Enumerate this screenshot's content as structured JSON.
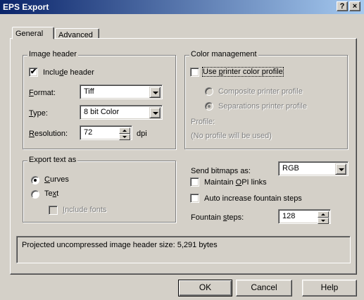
{
  "window": {
    "title": "EPS Export",
    "help_label": "?",
    "close_label": "×"
  },
  "tabs": [
    {
      "label": "General",
      "active": true
    },
    {
      "label": "Advanced",
      "active": false
    }
  ],
  "image_header": {
    "legend": "Image header",
    "include_header": {
      "pre": "Inclu",
      "u": "d",
      "post": "e header",
      "checked": true
    },
    "format": {
      "u": "F",
      "post": "ormat:",
      "value": "Tiff"
    },
    "type": {
      "u": "T",
      "post": "ype:",
      "value": "8 bit Color"
    },
    "resolution": {
      "u": "R",
      "post": "esolution:",
      "value": "72",
      "unit": "dpi"
    }
  },
  "color_management": {
    "legend": "Color management",
    "use_printer_profile": {
      "pre": "Use ",
      "u": "p",
      "post": "rinter color profile",
      "checked": false
    },
    "composite_label": "Composite printer profile",
    "separations_label": "Separations printer profile",
    "profile_label": "Profile:",
    "profile_value": "(No profile will be used)"
  },
  "export_text": {
    "legend": "Export text as",
    "curves": {
      "u": "C",
      "post": "urves",
      "selected": true
    },
    "text": {
      "pre": "Te",
      "u": "x",
      "post": "t",
      "selected": false
    },
    "include_fonts": {
      "u": "I",
      "post": "nclude fonts",
      "checked": false
    }
  },
  "bitmaps": {
    "send_label": "Send bitmaps as:",
    "send_value": "RGB",
    "maintain_opi": {
      "pre": "Maintain ",
      "u": "O",
      "post": "PI links",
      "checked": false
    },
    "auto_increase": {
      "label": "Auto increase fountain steps",
      "checked": false
    },
    "fountain": {
      "pre": "Fountain ",
      "u": "s",
      "post": "teps:",
      "value": "128"
    }
  },
  "status_text": "Projected uncompressed image header size: 5,291 bytes",
  "buttons": {
    "ok": "OK",
    "cancel": "Cancel",
    "help": "Help"
  }
}
